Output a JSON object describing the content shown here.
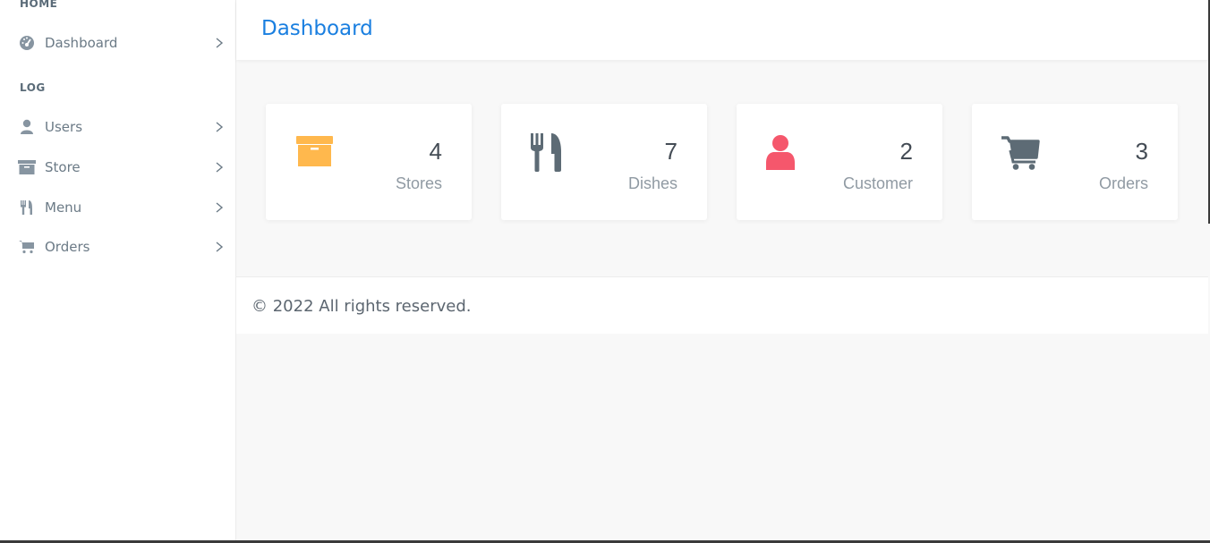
{
  "sidebar": {
    "sections": [
      {
        "label": "HOME"
      },
      {
        "label": "LOG"
      }
    ],
    "items": [
      {
        "label": "Dashboard",
        "icon": "dashboard-gauge-icon"
      },
      {
        "label": "Users",
        "icon": "user-icon"
      },
      {
        "label": "Store",
        "icon": "archive-box-icon"
      },
      {
        "label": "Menu",
        "icon": "fork-knife-icon"
      },
      {
        "label": "Orders",
        "icon": "cart-icon"
      }
    ]
  },
  "header": {
    "title": "Dashboard"
  },
  "cards": [
    {
      "value": "4",
      "label": "Stores",
      "icon": "archive-box-icon",
      "color": "#ffb84d"
    },
    {
      "value": "7",
      "label": "Dishes",
      "icon": "fork-knife-icon",
      "color": "#5d6b75"
    },
    {
      "value": "2",
      "label": "Customer",
      "icon": "user-icon",
      "color": "#f5576c"
    },
    {
      "value": "3",
      "label": "Orders",
      "icon": "cart-icon",
      "color": "#5d6b75"
    }
  ],
  "footer": {
    "copyright": "© 2022 All rights reserved."
  },
  "colors": {
    "accent": "#1a7fe0",
    "sidebar_icon": "#8795a1"
  }
}
